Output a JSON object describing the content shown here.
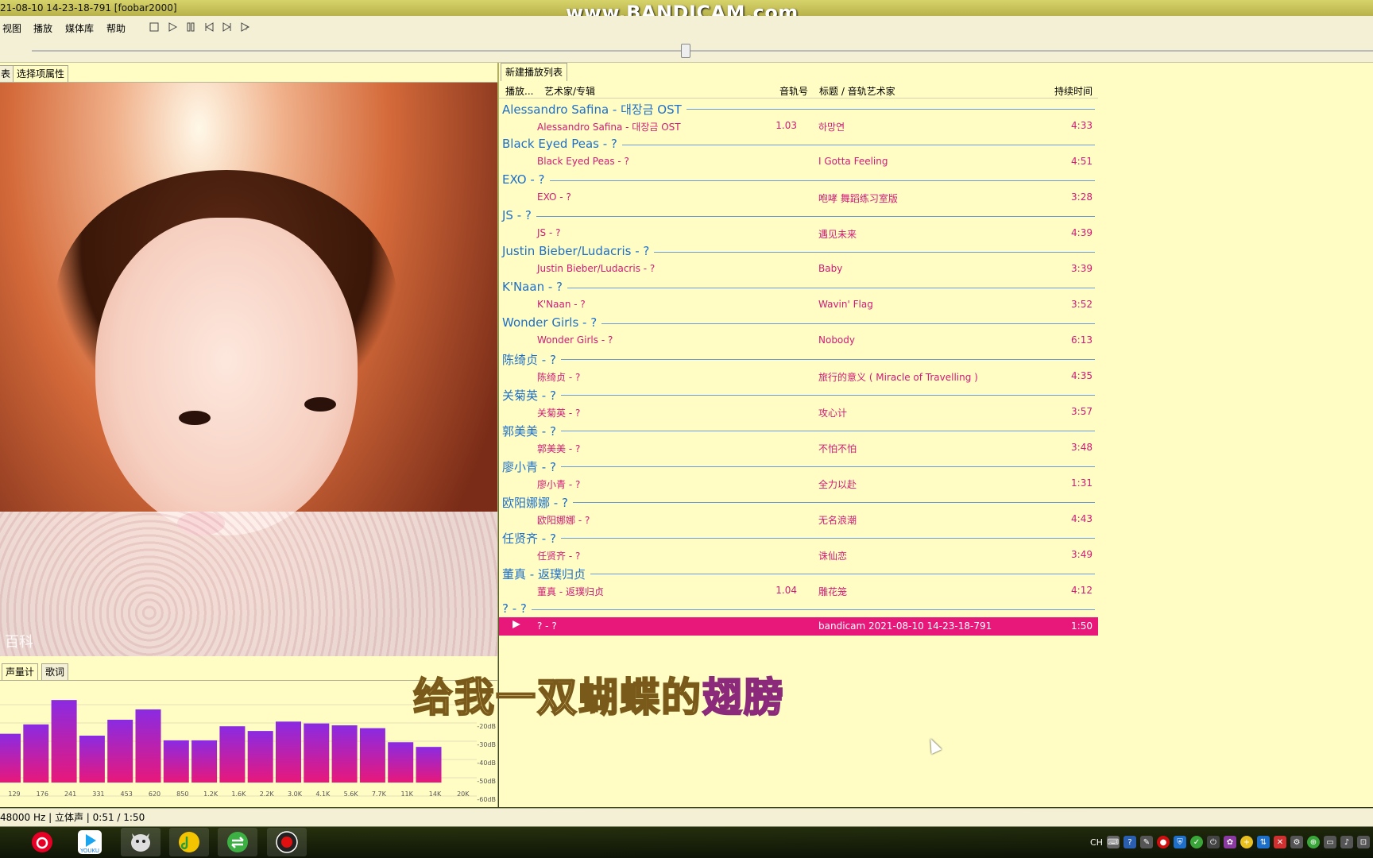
{
  "window": {
    "title": "21-08-10 14-23-18-791  [foobar2000]",
    "watermark": "www.BANDICAM.com"
  },
  "menu": [
    "视图",
    "播放",
    "媒体库",
    "帮助"
  ],
  "toolbar_icons": [
    "stop-icon",
    "play-icon",
    "pause-icon",
    "previous-icon",
    "next-icon",
    "random-icon"
  ],
  "left_tabs": [
    "表",
    "选择项属性"
  ],
  "album_art": {
    "logo": "百科"
  },
  "bottom_tabs": [
    "声量计",
    "歌词"
  ],
  "spectrum": {
    "freq_labels": [
      "129",
      "176",
      "241",
      "331",
      "453",
      "620",
      "850",
      "1.2K",
      "1.6K",
      "2.2K",
      "3.0K",
      "4.1K",
      "5.6K",
      "7.7K",
      "11K",
      "14K",
      "20K"
    ],
    "db_labels": [
      "-20dB",
      "-30dB",
      "-40dB",
      "-50dB",
      "-60dB"
    ],
    "levels": [
      0.52,
      0.62,
      0.88,
      0.5,
      0.67,
      0.78,
      0.45,
      0.45,
      0.6,
      0.55,
      0.65,
      0.63,
      0.61,
      0.58,
      0.43,
      0.38
    ],
    "colors": {
      "top": "#8a2be2",
      "bottom": "#e8187a"
    }
  },
  "playlist": {
    "tab": "新建播放列表",
    "columns": {
      "playing": "播放...",
      "artist_album": "艺术家/专辑",
      "track_no": "音轨号",
      "title_artist": "标题 / 音轨艺术家",
      "duration": "持续时间"
    },
    "groups": [
      {
        "label": "Alessandro Safina - 대장금 OST",
        "tracks": [
          {
            "artist_album": "Alessandro Safina - 대장금 OST",
            "track_no": "1.03",
            "title": "하망연",
            "duration": "4:33"
          }
        ]
      },
      {
        "label": "Black Eyed Peas - ?",
        "tracks": [
          {
            "artist_album": "Black Eyed Peas - ?",
            "track_no": "",
            "title": "I Gotta Feeling",
            "duration": "4:51"
          }
        ]
      },
      {
        "label": "EXO - ?",
        "tracks": [
          {
            "artist_album": "EXO - ?",
            "track_no": "",
            "title": "咆哮 舞蹈练习室版",
            "duration": "3:28"
          }
        ]
      },
      {
        "label": "JS - ?",
        "tracks": [
          {
            "artist_album": "JS - ?",
            "track_no": "",
            "title": "遇见未来",
            "duration": "4:39"
          }
        ]
      },
      {
        "label": "Justin Bieber/Ludacris - ?",
        "tracks": [
          {
            "artist_album": "Justin Bieber/Ludacris - ?",
            "track_no": "",
            "title": "Baby",
            "duration": "3:39"
          }
        ]
      },
      {
        "label": "K'Naan - ?",
        "tracks": [
          {
            "artist_album": "K'Naan - ?",
            "track_no": "",
            "title": "Wavin' Flag",
            "duration": "3:52"
          }
        ]
      },
      {
        "label": "Wonder Girls - ?",
        "tracks": [
          {
            "artist_album": "Wonder Girls - ?",
            "track_no": "",
            "title": "Nobody",
            "duration": "6:13"
          }
        ]
      },
      {
        "label": "陈绮贞 - ?",
        "tracks": [
          {
            "artist_album": "陈绮贞 - ?",
            "track_no": "",
            "title": "旅行的意义 ( Miracle of Travelling )",
            "duration": "4:35"
          }
        ]
      },
      {
        "label": "关菊英 - ?",
        "tracks": [
          {
            "artist_album": "关菊英 - ?",
            "track_no": "",
            "title": "攻心计",
            "duration": "3:57"
          }
        ]
      },
      {
        "label": "郭美美 - ?",
        "tracks": [
          {
            "artist_album": "郭美美 - ?",
            "track_no": "",
            "title": "不怕不怕",
            "duration": "3:48"
          }
        ]
      },
      {
        "label": "廖小青 - ?",
        "tracks": [
          {
            "artist_album": "廖小青 - ?",
            "track_no": "",
            "title": "全力以赴",
            "duration": "1:31"
          }
        ]
      },
      {
        "label": "欧阳娜娜 - ?",
        "tracks": [
          {
            "artist_album": "欧阳娜娜 - ?",
            "track_no": "",
            "title": "无名浪潮",
            "duration": "4:43"
          }
        ]
      },
      {
        "label": "任贤齐 - ?",
        "tracks": [
          {
            "artist_album": "任贤齐 - ?",
            "track_no": "",
            "title": "诛仙恋",
            "duration": "3:49"
          }
        ]
      },
      {
        "label": "董真 - 返璞归贞",
        "tracks": [
          {
            "artist_album": "董真 - 返璞归贞",
            "track_no": "1.04",
            "title": "雕花笼",
            "duration": "4:12"
          }
        ]
      },
      {
        "label": "? - ?",
        "tracks": [
          {
            "artist_album": "? - ?",
            "track_no": "",
            "title": "bandicam 2021-08-10 14-23-18-791",
            "duration": "1:50",
            "playing": true
          }
        ]
      }
    ]
  },
  "lyric": {
    "text": "给我一双蝴蝶的",
    "highlight": "翅膀"
  },
  "status": "48000 Hz | 立体声 | 0:51 / 1:50",
  "taskbar": {
    "apps": [
      "netease-music-icon",
      "youku-icon",
      "foobar-icon",
      "qq-music-icon",
      "green-app-icon",
      "bandicam-icon"
    ],
    "youku_label": "YOUKU",
    "tray_lang": "CH"
  }
}
